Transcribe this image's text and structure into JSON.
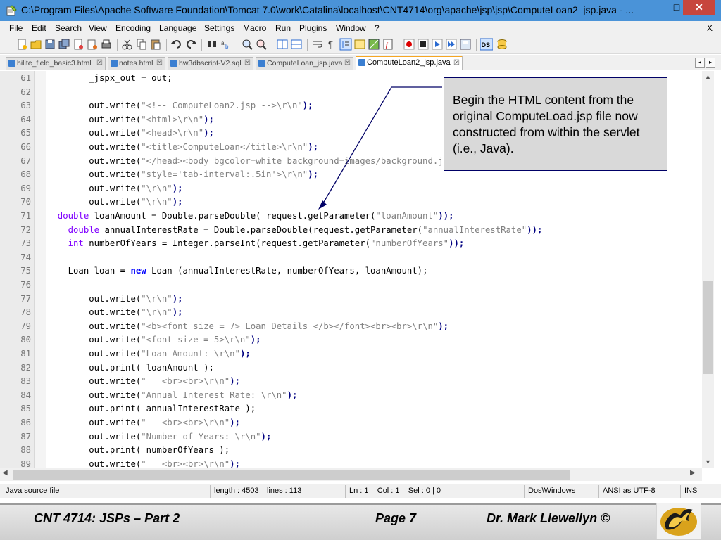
{
  "window": {
    "title": "C:\\Program Files\\Apache Software Foundation\\Tomcat 7.0\\work\\Catalina\\localhost\\CNT4714\\org\\apache\\jsp\\jsp\\ComputeLoan2_jsp.java - ...",
    "minimize": "–",
    "maximize": "□",
    "close": "✕"
  },
  "menu": {
    "items": [
      "File",
      "Edit",
      "Search",
      "View",
      "Encoding",
      "Language",
      "Settings",
      "Macro",
      "Run",
      "Plugins",
      "Window",
      "?"
    ],
    "close": "X"
  },
  "tabs": [
    {
      "label": "hilite_field_basic3.html",
      "close": "☒"
    },
    {
      "label": "notes.html",
      "close": "☒"
    },
    {
      "label": "hw3dbscript-V2.sql",
      "close": "☒"
    },
    {
      "label": "ComputeLoan_jsp.java",
      "close": "☒"
    },
    {
      "label": "ComputeLoan2_jsp.java",
      "close": "☒"
    }
  ],
  "editor": {
    "lines": [
      {
        "n": "61",
        "segs": [
          {
            "c": "plain",
            "t": "        _jspx_out = out;"
          }
        ]
      },
      {
        "n": "62",
        "segs": []
      },
      {
        "n": "63",
        "segs": [
          {
            "c": "plain",
            "t": "        out.write("
          },
          {
            "c": "str",
            "t": "\"<!-- ComputeLoan2.jsp -->\\r\\n\""
          },
          {
            "c": "op",
            "t": ");"
          }
        ]
      },
      {
        "n": "64",
        "segs": [
          {
            "c": "plain",
            "t": "        out.write("
          },
          {
            "c": "str",
            "t": "\"<html>\\r\\n\""
          },
          {
            "c": "op",
            "t": ");"
          }
        ]
      },
      {
        "n": "65",
        "segs": [
          {
            "c": "plain",
            "t": "        out.write("
          },
          {
            "c": "str",
            "t": "\"<head>\\r\\n\""
          },
          {
            "c": "op",
            "t": ");"
          }
        ]
      },
      {
        "n": "66",
        "segs": [
          {
            "c": "plain",
            "t": "        out.write("
          },
          {
            "c": "str",
            "t": "\"<title>ComputeLoan</title>\\r\\n\""
          },
          {
            "c": "op",
            "t": ");"
          }
        ]
      },
      {
        "n": "67",
        "segs": [
          {
            "c": "plain",
            "t": "        out.write("
          },
          {
            "c": "str",
            "t": "\"</head><body bgcolor=white background=images/background.jpg vlink=black link=bl"
          }
        ]
      },
      {
        "n": "68",
        "segs": [
          {
            "c": "plain",
            "t": "        out.write("
          },
          {
            "c": "str",
            "t": "\"style='tab-interval:.5in'>\\r\\n\""
          },
          {
            "c": "op",
            "t": ");"
          }
        ]
      },
      {
        "n": "69",
        "segs": [
          {
            "c": "plain",
            "t": "        out.write("
          },
          {
            "c": "str",
            "t": "\"\\r\\n\""
          },
          {
            "c": "op",
            "t": ");"
          }
        ]
      },
      {
        "n": "70",
        "segs": [
          {
            "c": "plain",
            "t": "        out.write("
          },
          {
            "c": "str",
            "t": "\"\\r\\n\""
          },
          {
            "c": "op",
            "t": ");"
          }
        ]
      },
      {
        "n": "71",
        "segs": [
          {
            "c": "kt",
            "t": "  double"
          },
          {
            "c": "plain",
            "t": " loanAmount = Double.parseDouble( request.getParameter("
          },
          {
            "c": "str",
            "t": "\"loanAmount\""
          },
          {
            "c": "op",
            "t": "));"
          }
        ]
      },
      {
        "n": "72",
        "segs": [
          {
            "c": "kt",
            "t": "    double"
          },
          {
            "c": "plain",
            "t": " annualInterestRate = Double.parseDouble(request.getParameter("
          },
          {
            "c": "str",
            "t": "\"annualInterestRate\""
          },
          {
            "c": "op",
            "t": "));"
          }
        ]
      },
      {
        "n": "73",
        "segs": [
          {
            "c": "kt",
            "t": "    int"
          },
          {
            "c": "plain",
            "t": " numberOfYears = Integer.parseInt(request.getParameter("
          },
          {
            "c": "str",
            "t": "\"numberOfYears\""
          },
          {
            "c": "op",
            "t": "));"
          }
        ]
      },
      {
        "n": "74",
        "segs": []
      },
      {
        "n": "75",
        "segs": [
          {
            "c": "plain",
            "t": "    Loan loan = "
          },
          {
            "c": "kw",
            "t": "new"
          },
          {
            "c": "plain",
            "t": " Loan (annualInterestRate, numberOfYears, loanAmount);"
          }
        ]
      },
      {
        "n": "76",
        "segs": []
      },
      {
        "n": "77",
        "segs": [
          {
            "c": "plain",
            "t": "        out.write("
          },
          {
            "c": "str",
            "t": "\"\\r\\n\""
          },
          {
            "c": "op",
            "t": ");"
          }
        ]
      },
      {
        "n": "78",
        "segs": [
          {
            "c": "plain",
            "t": "        out.write("
          },
          {
            "c": "str",
            "t": "\"\\r\\n\""
          },
          {
            "c": "op",
            "t": ");"
          }
        ]
      },
      {
        "n": "79",
        "segs": [
          {
            "c": "plain",
            "t": "        out.write("
          },
          {
            "c": "str",
            "t": "\"<b><font size = 7> Loan Details </b></font><br><br>\\r\\n\""
          },
          {
            "c": "op",
            "t": ");"
          }
        ]
      },
      {
        "n": "80",
        "segs": [
          {
            "c": "plain",
            "t": "        out.write("
          },
          {
            "c": "str",
            "t": "\"<font size = 5>\\r\\n\""
          },
          {
            "c": "op",
            "t": ");"
          }
        ]
      },
      {
        "n": "81",
        "segs": [
          {
            "c": "plain",
            "t": "        out.write("
          },
          {
            "c": "str",
            "t": "\"Loan Amount: \\r\\n\""
          },
          {
            "c": "op",
            "t": ");"
          }
        ]
      },
      {
        "n": "82",
        "segs": [
          {
            "c": "plain",
            "t": "        out.print( loanAmount );"
          }
        ]
      },
      {
        "n": "83",
        "segs": [
          {
            "c": "plain",
            "t": "        out.write("
          },
          {
            "c": "str",
            "t": "\"   <br><br>\\r\\n\""
          },
          {
            "c": "op",
            "t": ");"
          }
        ]
      },
      {
        "n": "84",
        "segs": [
          {
            "c": "plain",
            "t": "        out.write("
          },
          {
            "c": "str",
            "t": "\"Annual Interest Rate: \\r\\n\""
          },
          {
            "c": "op",
            "t": ");"
          }
        ]
      },
      {
        "n": "85",
        "segs": [
          {
            "c": "plain",
            "t": "        out.print( annualInterestRate );"
          }
        ]
      },
      {
        "n": "86",
        "segs": [
          {
            "c": "plain",
            "t": "        out.write("
          },
          {
            "c": "str",
            "t": "\"   <br><br>\\r\\n\""
          },
          {
            "c": "op",
            "t": ");"
          }
        ]
      },
      {
        "n": "87",
        "segs": [
          {
            "c": "plain",
            "t": "        out.write("
          },
          {
            "c": "str",
            "t": "\"Number of Years: \\r\\n\""
          },
          {
            "c": "op",
            "t": ");"
          }
        ]
      },
      {
        "n": "88",
        "segs": [
          {
            "c": "plain",
            "t": "        out.print( numberOfYears );"
          }
        ]
      },
      {
        "n": "89",
        "segs": [
          {
            "c": "plain",
            "t": "        out.write("
          },
          {
            "c": "str",
            "t": "\"   <br><br>\\r\\n\""
          },
          {
            "c": "op",
            "t": ");"
          }
        ]
      }
    ]
  },
  "status": {
    "file_type": "Java source file",
    "length": "length : 4503",
    "lines": "lines : 113",
    "position": "Ln : 1    Col : 1    Sel : 0 | 0",
    "eol": "Dos\\Windows",
    "encoding": "ANSI as UTF-8",
    "mode": "INS"
  },
  "callout": {
    "text": "Begin the HTML content from the original ComputeLoad.jsp file now constructed from within the servlet (i.e., Java)."
  },
  "footer": {
    "course": "CNT 4714: JSPs – Part 2",
    "page": "Page 7",
    "author": "Dr. Mark Llewellyn ©"
  },
  "colors": {
    "titlebar": "#4a93d8",
    "close_button": "#c7463d",
    "keyword": "#0000ff",
    "type": "#8000ff",
    "string": "#808080",
    "active_tab_accent": "#f5a623"
  }
}
